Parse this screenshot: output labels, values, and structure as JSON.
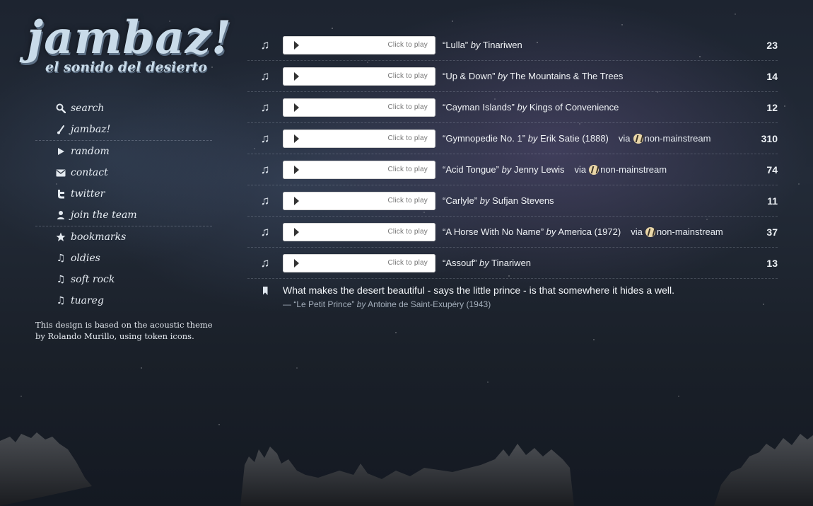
{
  "logo": {
    "title": "jambaz!",
    "subtitle": "el sonido del desierto"
  },
  "nav": [
    {
      "label": "search",
      "icon": "search-icon"
    },
    {
      "label": "jambaz!",
      "icon": "guitar-icon"
    },
    {
      "label": "random",
      "icon": "play-icon"
    },
    {
      "label": "contact",
      "icon": "mail-icon"
    },
    {
      "label": "twitter",
      "icon": "twitter-icon"
    },
    {
      "label": "join the team",
      "icon": "user-icon"
    },
    {
      "label": "bookmarks",
      "icon": "star-icon"
    },
    {
      "label": "oldies",
      "icon": "music-note-icon"
    },
    {
      "label": "soft rock",
      "icon": "music-note-icon"
    },
    {
      "label": "tuareg",
      "icon": "music-note-icon"
    }
  ],
  "credit": "This design is based on the acoustic theme by Rolando Murillo, using token icons.",
  "player_caption": "Click to play",
  "by_word": "by",
  "via_word": "via",
  "tracks": [
    {
      "title": "“Lulla”",
      "artist": "Tinariwen",
      "year": "",
      "via": "",
      "count": "23",
      "by": "by"
    },
    {
      "title": "“Up & Down”",
      "artist": "The Mountains & The Trees",
      "year": "",
      "via": "",
      "count": "14",
      "by": "by"
    },
    {
      "title": "“Cayman Islands”",
      "artist": "Kings of Convenience",
      "year": "",
      "via": "",
      "count": "12",
      "by": "by"
    },
    {
      "title": "“Gymnopedie No. 1”",
      "artist": "Erik Satie",
      "year": "(1888)",
      "via": "non-mainstream",
      "count": "310",
      "by": "by"
    },
    {
      "title": "“Acid Tongue”",
      "artist": "Jenny Lewis",
      "year": "",
      "via": "non-mainstream",
      "count": "74",
      "by": "by"
    },
    {
      "title": "“Carlyle”",
      "artist": "Sufjan Stevens",
      "year": "",
      "via": "",
      "count": "11",
      "by": "by"
    },
    {
      "title": "“A Horse With No Name”",
      "artist": "America",
      "year": "(1972)",
      "via": "non-mainstream",
      "count": "37",
      "by": "by"
    },
    {
      "title": "“Assouf”",
      "artist": "Tinariwen",
      "year": "",
      "via": "",
      "count": "13",
      "by": "by"
    }
  ],
  "quote": {
    "text": "What makes the desert beautiful - says the little prince - is that somewhere it hides a well.",
    "source_prefix": "— “Le Petit Prince”",
    "source_by": "by",
    "source_author": "Antoine de Saint-Exupéry (1943)"
  },
  "colors": {
    "background": "#1d2430",
    "text": "#dfe6ee",
    "player": "#ffffff"
  }
}
